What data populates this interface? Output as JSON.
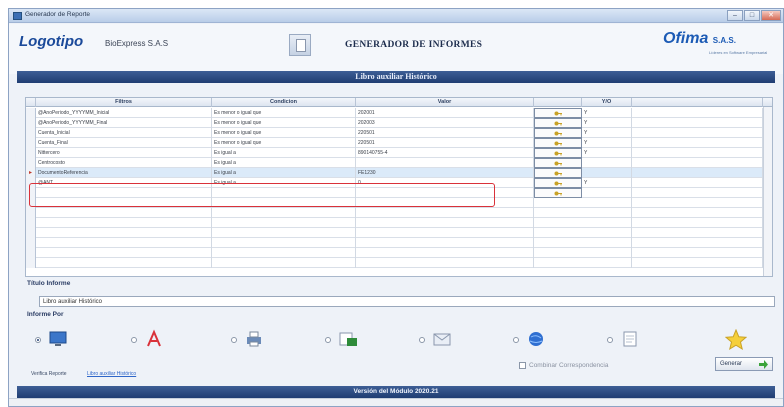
{
  "window": {
    "title": "Generador de Reporte"
  },
  "header": {
    "logo": "Logotipo",
    "company": "BioExpress S.A.S",
    "title": "GENERADOR DE INFORMES",
    "brand": "Ofima",
    "brand_suffix": "S.A.S.",
    "brand_tagline": "Líderes en Software Empresarial"
  },
  "section_title": "Libro auxiliar Histórico",
  "grid": {
    "columns": [
      "Filtros",
      "Condicion",
      "Valor",
      "Y/O"
    ],
    "rows": [
      {
        "filtro": "@AnoPeriodo_YYYYMM_Inicial",
        "condicion": "Es menor o igual que",
        "valor": "202001",
        "yo": "Y"
      },
      {
        "filtro": "@AnoPeriodo_YYYYMM_Final",
        "condicion": "Es menor o igual que",
        "valor": "202003",
        "yo": "Y"
      },
      {
        "filtro": "Cuenta_Inicial",
        "condicion": "Es menor o igual que",
        "valor": "220501",
        "yo": "Y"
      },
      {
        "filtro": "Cuenta_Final",
        "condicion": "Es menor o igual que",
        "valor": "220501",
        "yo": "Y"
      },
      {
        "filtro": "Nittercero",
        "condicion": "Es igual a",
        "valor": "890140755-4",
        "yo": "Y"
      },
      {
        "filtro": "Centrocosto",
        "condicion": "Es igual a",
        "valor": "",
        "yo": ""
      },
      {
        "filtro": "DocumentoReferencia",
        "condicion": "Es igual a",
        "valor": "FE1230",
        "yo": ""
      },
      {
        "filtro": "@ANT",
        "condicion": "Es igual a",
        "valor": "0",
        "yo": "Y"
      }
    ],
    "selected_row": 6
  },
  "report_title": {
    "label": "Título Informe",
    "value": "Libro auxiliar Histórico"
  },
  "export": {
    "label": "Informe Por",
    "options": [
      {
        "icon": "screen-icon",
        "selected": true
      },
      {
        "icon": "pdf-icon",
        "selected": false
      },
      {
        "icon": "printer-icon",
        "selected": false
      },
      {
        "icon": "excel-icon",
        "selected": false
      },
      {
        "icon": "email-icon",
        "selected": false
      },
      {
        "icon": "web-icon",
        "selected": false
      },
      {
        "icon": "document-icon",
        "selected": false
      },
      {
        "icon": "star-icon",
        "selected": false
      }
    ]
  },
  "footer": {
    "verify_label": "Verifica Reporte",
    "verify_link": "Libro auxiliar Histórico",
    "combine_label": "Combinar Correspondencia",
    "generate_label": "Generar",
    "version": "Versión del Módulo 2020.21"
  },
  "colors": {
    "accent": "#1f3d72",
    "highlight": "#d9323a",
    "selected_row": "#dbeaf9"
  }
}
